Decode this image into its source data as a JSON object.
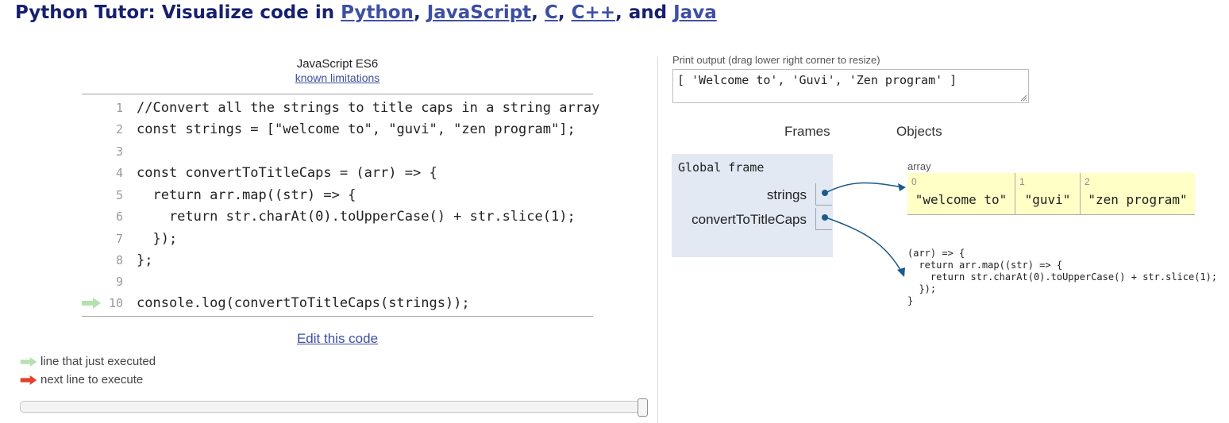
{
  "header": {
    "prefix": "Python Tutor: Visualize code in ",
    "links": [
      "Python",
      "JavaScript",
      "C",
      "C++",
      "Java"
    ],
    "sep1": ", ",
    "sep2": ", ",
    "sep3": ", ",
    "sep4": ", and "
  },
  "editor": {
    "language": "JavaScript ES6",
    "limitations_link": "known limitations",
    "lines": [
      {
        "num": "1",
        "text": "//Convert all the strings to title caps in a string array"
      },
      {
        "num": "2",
        "text": "const strings = [\"welcome to\", \"guvi\", \"zen program\"];"
      },
      {
        "num": "3",
        "text": ""
      },
      {
        "num": "4",
        "text": "const convertToTitleCaps = (arr) => {"
      },
      {
        "num": "5",
        "text": "  return arr.map((str) => {"
      },
      {
        "num": "6",
        "text": "    return str.charAt(0).toUpperCase() + str.slice(1);"
      },
      {
        "num": "7",
        "text": "  });"
      },
      {
        "num": "8",
        "text": "};"
      },
      {
        "num": "9",
        "text": ""
      },
      {
        "num": "10",
        "text": "console.log(convertToTitleCaps(strings));"
      }
    ],
    "edit_link": "Edit this code"
  },
  "legend": {
    "just_executed": "line that just executed",
    "next_to_execute": "next line to execute",
    "green": "#b4e1b0",
    "red": "#e4402c"
  },
  "output": {
    "label": "Print output (drag lower right corner to resize)",
    "text": "[ 'Welcome to', 'Guvi', 'Zen program' ]"
  },
  "viz": {
    "frames_label": "Frames",
    "objects_label": "Objects",
    "global_frame": "Global frame",
    "vars": [
      "strings",
      "convertToTitleCaps"
    ],
    "array_label": "array",
    "array": [
      {
        "idx": "0",
        "val": "\"welcome to\""
      },
      {
        "idx": "1",
        "val": "\"guvi\""
      },
      {
        "idx": "2",
        "val": "\"zen program\""
      }
    ],
    "function_text": "(arr) => {\n  return arr.map((str) => {\n    return str.charAt(0).toUpperCase() + str.slice(1);\n  });\n}",
    "pointer_color": "#1b5a8a"
  }
}
